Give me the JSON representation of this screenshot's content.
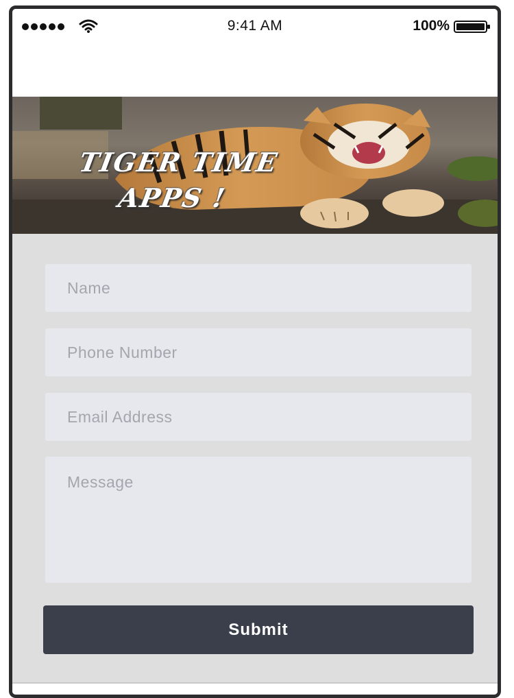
{
  "status_bar": {
    "time": "9:41 AM",
    "battery_percent": "100%",
    "signal_icon": "signal-dots-icon",
    "wifi_icon": "wifi-icon",
    "battery_icon": "battery-icon"
  },
  "hero": {
    "title": "TIGER TIME\nAPPS !",
    "image": "tiger-photo"
  },
  "form": {
    "name_placeholder": "Name",
    "phone_placeholder": "Phone Number",
    "email_placeholder": "Email Address",
    "message_placeholder": "Message",
    "submit_label": "Submit"
  },
  "colors": {
    "form_background": "#dedede",
    "field_background": "#e7e8ed",
    "button_background": "#3a3f4b",
    "button_text": "#ffffff"
  }
}
